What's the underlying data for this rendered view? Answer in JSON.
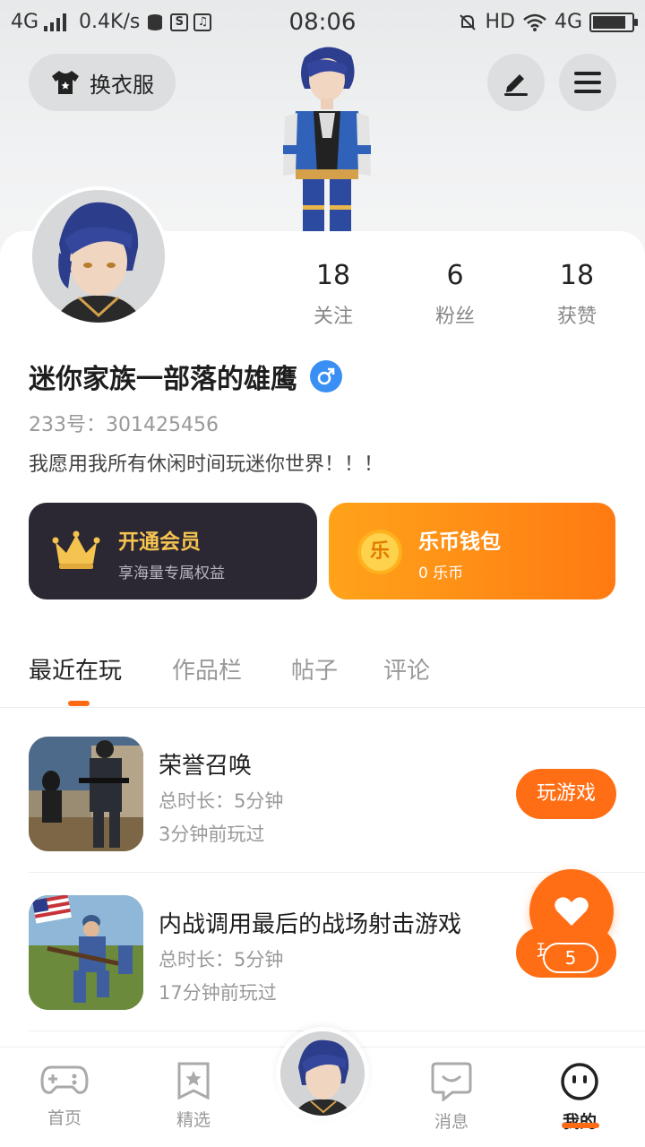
{
  "status_bar": {
    "network_left": "4G",
    "speed": "0.4K/s",
    "time": "08:06",
    "hd": "HD",
    "network_right": "4G"
  },
  "header": {
    "wardrobe_label": "换衣服",
    "edit_icon": "edit-icon",
    "menu_icon": "menu-icon"
  },
  "profile": {
    "stats": [
      {
        "value": "18",
        "label": "关注"
      },
      {
        "value": "6",
        "label": "粉丝"
      },
      {
        "value": "18",
        "label": "获赞"
      }
    ],
    "username": "迷你家族一部落的雄鹰",
    "gender_icon": "male-icon",
    "uid": "233号：301425456",
    "bio": "我愿用我所有休闲时间玩迷你世界！！！"
  },
  "cards": {
    "vip": {
      "title": "开通会员",
      "subtitle": "享海量专属权益"
    },
    "wallet": {
      "title": "乐币钱包",
      "subtitle": "0 乐币",
      "coin_glyph": "乐"
    }
  },
  "tabs": [
    {
      "label": "最近在玩",
      "active": true
    },
    {
      "label": "作品栏",
      "active": false
    },
    {
      "label": "帖子",
      "active": false
    },
    {
      "label": "评论",
      "active": false
    }
  ],
  "games": [
    {
      "title": "荣誉召唤",
      "duration": "总时长：5分钟",
      "last_played": "3分钟前玩过",
      "button": "玩游戏"
    },
    {
      "title": "内战调用最后的战场射击游戏",
      "duration": "总时长：5分钟",
      "last_played": "17分钟前玩过",
      "button": "玩游戏"
    }
  ],
  "like_fab": {
    "count": "5"
  },
  "bottom_nav": [
    {
      "label": "首页",
      "icon": "gamepad-icon",
      "active": false
    },
    {
      "label": "精选",
      "icon": "star-icon",
      "active": false
    },
    {
      "label": "",
      "icon": "avatar",
      "active": false
    },
    {
      "label": "消息",
      "icon": "message-icon",
      "active": false
    },
    {
      "label": "我的",
      "icon": "smiley-icon",
      "active": true
    }
  ],
  "colors": {
    "accent": "#ff6e14",
    "vip_bg": "#2b2833",
    "gold": "#f5c350",
    "male": "#3a8ff5"
  }
}
